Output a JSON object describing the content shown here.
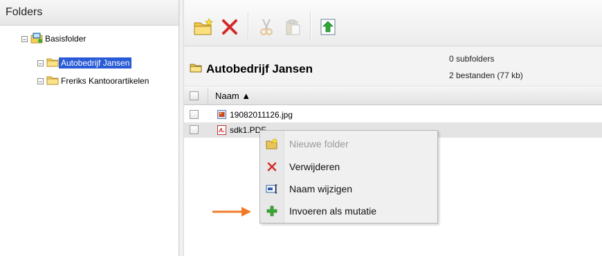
{
  "left_panel": {
    "title": "Folders",
    "tree": {
      "root_label": "Basisfolder",
      "root_toggle": "−",
      "children": [
        {
          "label": "Autobedrijf Jansen",
          "toggle": "−",
          "selected": true
        },
        {
          "label": "Freriks Kantoorartikelen",
          "toggle": "−",
          "selected": false
        }
      ]
    }
  },
  "toolbar": {
    "buttons": [
      {
        "icon": "new-folder-icon",
        "enabled": true
      },
      {
        "icon": "delete-icon",
        "enabled": true
      },
      {
        "icon": "cut-icon",
        "enabled": false
      },
      {
        "icon": "paste-icon",
        "enabled": false
      },
      {
        "icon": "upload-icon",
        "enabled": true
      }
    ]
  },
  "folder": {
    "title": "Autobedrijf Jansen",
    "subfolders": "0 subfolders",
    "files_summary": "2 bestanden (77 kb)"
  },
  "table": {
    "column_name": "Naam ▲",
    "files": [
      {
        "name": "19082011126.jpg",
        "icon": "image-file-icon"
      },
      {
        "name": "sdk1.PDF",
        "icon": "pdf-file-icon"
      }
    ]
  },
  "context_menu": {
    "items": [
      {
        "label": "Nieuwe folder",
        "icon": "new-folder-icon",
        "enabled": false
      },
      {
        "label": "Verwijderen",
        "icon": "delete-icon",
        "enabled": true
      },
      {
        "label": "Naam wijzigen",
        "icon": "rename-icon",
        "enabled": true
      },
      {
        "label": "Invoeren als mutatie",
        "icon": "add-icon",
        "enabled": true
      }
    ]
  },
  "colors": {
    "selection": "#2a5bd7",
    "annotation_arrow": "#f07a2a",
    "delete_red": "#d42a2a",
    "add_green": "#3aaa35"
  }
}
